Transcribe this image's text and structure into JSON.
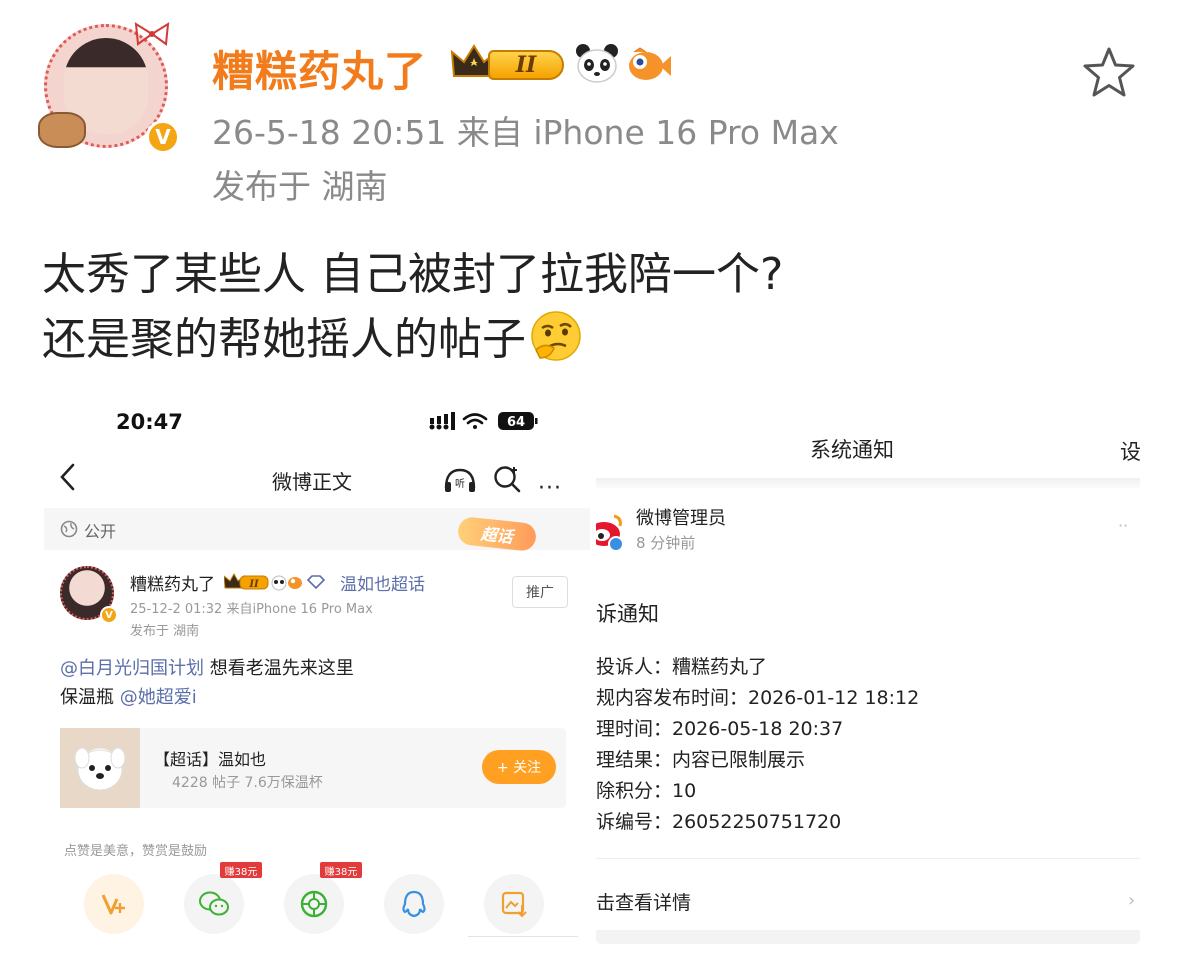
{
  "post": {
    "username": "糟糕药丸了",
    "level_badge": "II",
    "meta": "26-5-18 20:51  来自 iPhone 16 Pro Max",
    "location": "发布于 湖南",
    "verified": "V",
    "text_line1": "太秀了某些人 自己被封了拉我陪一个?",
    "text_line2": "还是聚的帮她摇人的帖子"
  },
  "left_screenshot": {
    "status_time": "20:47",
    "battery": "64",
    "nav_title": "微博正文",
    "nav_more": "···",
    "public_label": "公开",
    "chaohua_tag": "超话",
    "inner_post": {
      "username": "糟糕药丸了",
      "level_badge": "II",
      "topic_link": "温如也超话",
      "promote_label": "推广",
      "meta": "25-12-2 01:32  来自iPhone 16 Pro Max",
      "location": "发布于 湖南",
      "line1_mention": "@白月光归国计划",
      "line1_text": " 想看老温先来这里",
      "line2_text": "保温瓶 ",
      "line2_mention": "@她超爱i"
    },
    "topic_card": {
      "name": "【超话】温如也",
      "stats": "4228 帖子 7.6万保温杯",
      "follow_label": "+ 关注"
    },
    "like_hint": "点赞是美意，赞赏是鼓励",
    "share_items": [
      {
        "icon": "reward-icon",
        "tag": ""
      },
      {
        "icon": "wechat-icon",
        "tag": "赚38元"
      },
      {
        "icon": "moments-icon",
        "tag": "赚38元"
      },
      {
        "icon": "qq-icon",
        "tag": ""
      },
      {
        "icon": "save-image-icon",
        "tag": ""
      }
    ]
  },
  "right_screenshot": {
    "title": "系统通知",
    "side_label": "设",
    "sender_name": "微博管理员",
    "sender_time": "8 分钟前",
    "notice_title": "诉通知",
    "lines": [
      "投诉人：糟糕药丸了",
      "规内容发布时间：2026-01-12 18:12",
      "理时间：2026-05-18 20:37",
      "理结果：内容已限制展示",
      "除积分：10",
      "诉编号：26052250751720"
    ],
    "detail_link": "击查看详情",
    "detail_arrow": "›"
  },
  "colors": {
    "username": "#f27b1c",
    "meta_gray": "#8a8a8a",
    "link_blue": "#5b6ea8",
    "follow_orange": "#ffa022",
    "earn_red": "#e33b3b"
  }
}
